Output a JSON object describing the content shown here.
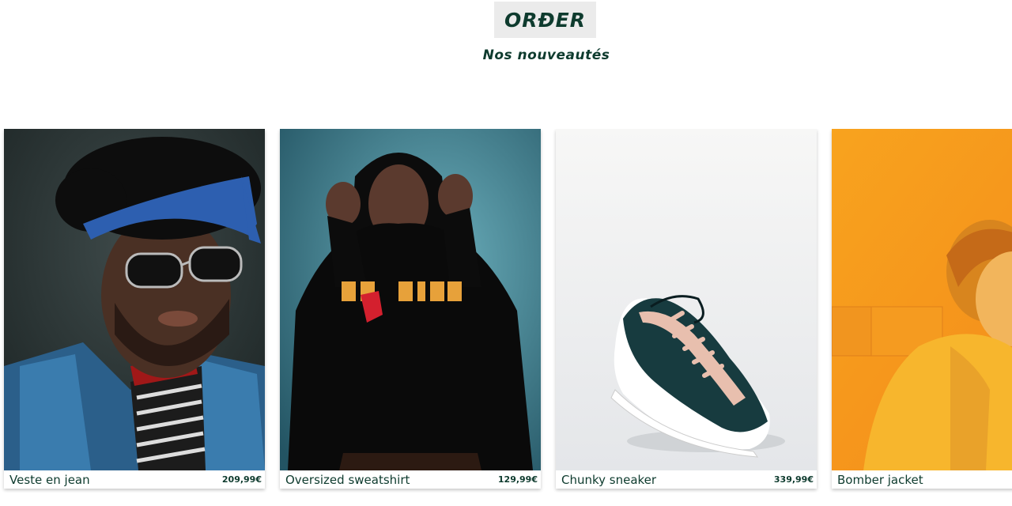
{
  "header": {
    "logo_text": "ORÐER",
    "subtitle": "Nos nouveautés"
  },
  "products": [
    {
      "name": "Veste en jean",
      "price": "209,99€",
      "image": "man-denim-jacket-photo"
    },
    {
      "name": "Oversized sweatshirt",
      "price": "129,99€",
      "image": "woman-black-hoodie-photo"
    },
    {
      "name": "Chunky sneaker",
      "price": "339,99€",
      "image": "sneaker-photo"
    },
    {
      "name": "Bomber jacket",
      "price": "",
      "image": "woman-yellow-jacket-photo"
    }
  ]
}
